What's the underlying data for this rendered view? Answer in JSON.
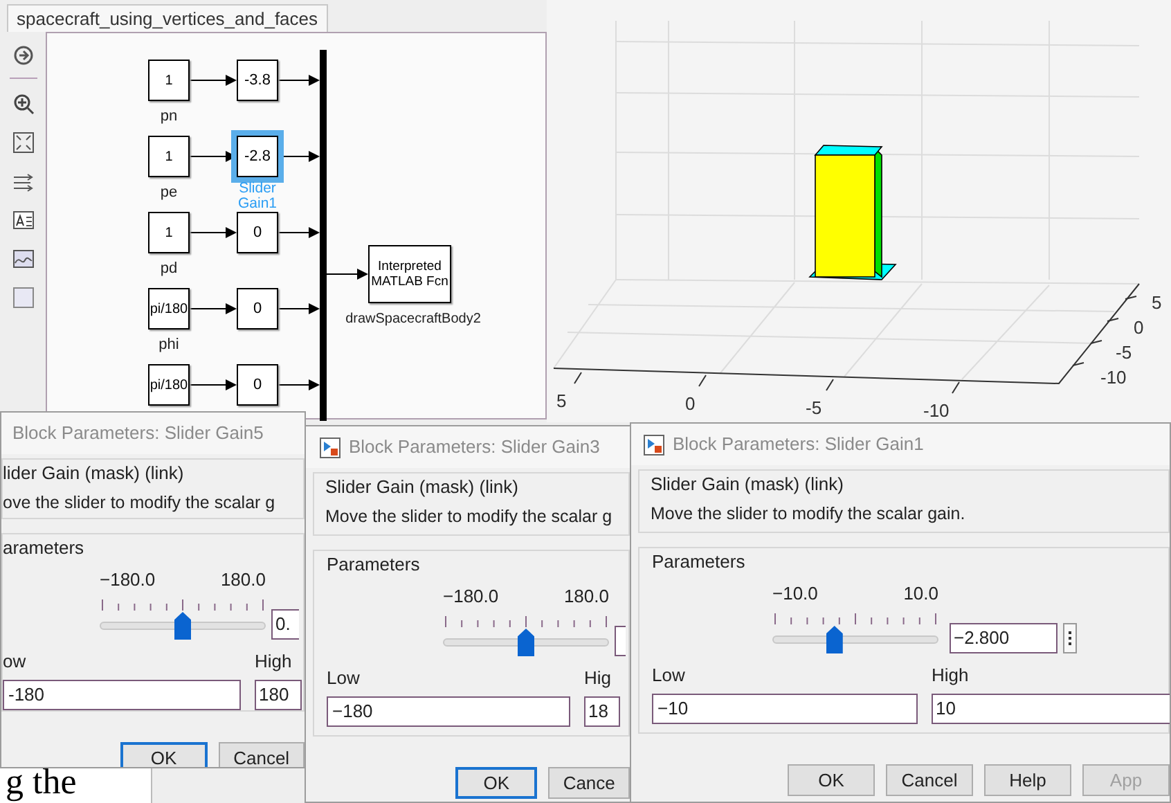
{
  "model_window": {
    "tab": "spacecraft_using_vertices_and_faces"
  },
  "diagram": {
    "rows": [
      {
        "constant": "1",
        "label": "pn",
        "gain": "-3.8",
        "selected": false
      },
      {
        "constant": "1",
        "label": "pe",
        "gain": "-2.8",
        "selected": true,
        "gain_label": "Slider Gain1"
      },
      {
        "constant": "1",
        "label": "pd",
        "gain": "0",
        "selected": false
      },
      {
        "constant": "pi/180",
        "label": "phi",
        "gain": "0",
        "selected": false
      },
      {
        "constant": "pi/180",
        "gain": "0",
        "selected": false
      }
    ],
    "function_block": {
      "text": "Interpreted MATLAB Fcn",
      "label": "drawSpacecraftBody2"
    }
  },
  "plot": {
    "x_ticks": [
      "5",
      "0",
      "-5",
      "-10"
    ],
    "y_ticks": [
      "5",
      "0",
      "-5",
      "-10"
    ]
  },
  "background_text": "g the",
  "dialogs": [
    {
      "title": "Block Parameters: Slider Gain5",
      "icon": false,
      "group": "lider Gain (mask) (link)",
      "description": "ove the slider to modify the scalar g",
      "parameters": "arameters",
      "slider": {
        "min": "−180.0",
        "max": "180.0",
        "level": 0.5
      },
      "value": "0.",
      "value_menu": false,
      "low_label": "ow",
      "low": "-180",
      "high_label": "High",
      "high": "180",
      "buttons": [
        {
          "label": "OK",
          "focused": true,
          "disabled": false
        },
        {
          "label": "Cancel",
          "focused": false,
          "disabled": false
        }
      ]
    },
    {
      "title": "Block Parameters: Slider Gain3",
      "icon": true,
      "group": "Slider Gain (mask) (link)",
      "description": "Move the slider to modify the scalar g",
      "parameters": "Parameters",
      "slider": {
        "min": "−180.0",
        "max": "180.0",
        "level": 0.5
      },
      "value_menu": false,
      "low_label": "Low",
      "low": "−180",
      "high_label": "Hig",
      "high": "18",
      "buttons": [
        {
          "label": "OK",
          "focused": true,
          "disabled": false
        },
        {
          "label": "Cance",
          "focused": false,
          "disabled": false
        }
      ]
    },
    {
      "title": "Block Parameters: Slider Gain1",
      "icon": true,
      "group": "Slider Gain (mask) (link)",
      "description": "Move the slider to modify the scalar gain.",
      "parameters": "Parameters",
      "slider": {
        "min": "−10.0",
        "max": "10.0",
        "level": 0.36
      },
      "value": "−2.800",
      "value_menu": true,
      "low_label": "Low",
      "low": "−10",
      "high_label": "High",
      "high": "10",
      "buttons": [
        {
          "label": "OK",
          "focused": false,
          "disabled": false
        },
        {
          "label": "Cancel",
          "focused": false,
          "disabled": false
        },
        {
          "label": "Help",
          "focused": false,
          "disabled": false
        },
        {
          "label": "App",
          "focused": false,
          "disabled": true
        }
      ]
    }
  ]
}
